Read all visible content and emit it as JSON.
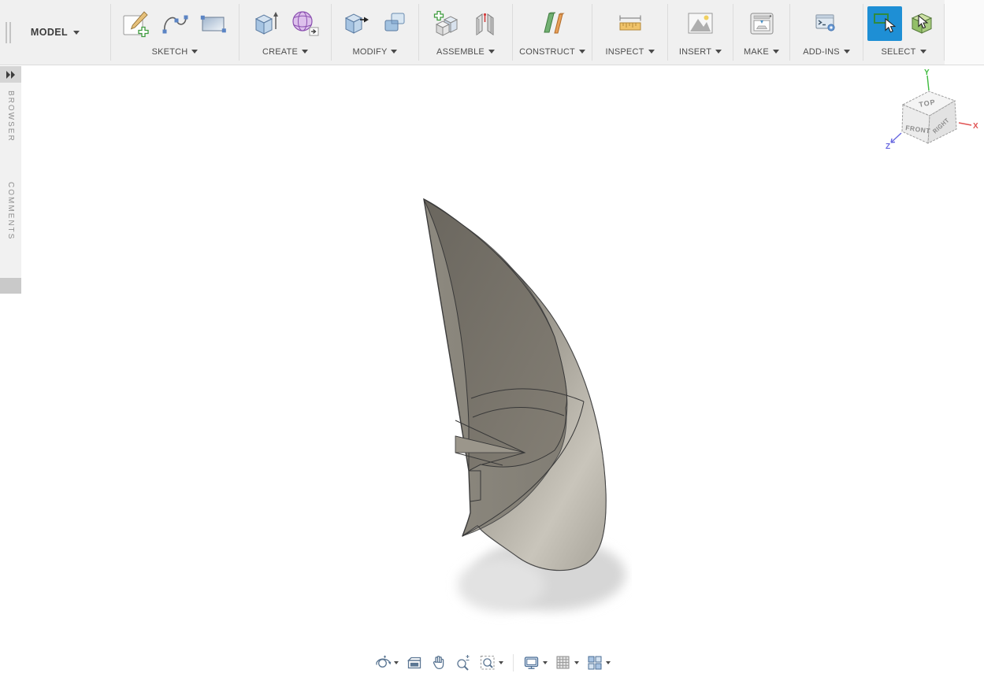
{
  "app": {
    "workspace_label": "MODEL"
  },
  "toolbar": {
    "model": {
      "label": "MODEL"
    },
    "groups": [
      {
        "label": "SKETCH",
        "icons": [
          "create-sketch-icon",
          "spline-icon",
          "two-point-rectangle-icon"
        ]
      },
      {
        "label": "CREATE",
        "icons": [
          "extrude-icon",
          "form-icon"
        ]
      },
      {
        "label": "MODIFY",
        "icons": [
          "press-pull-icon",
          "combine-icon"
        ]
      },
      {
        "label": "ASSEMBLE",
        "icons": [
          "new-component-icon",
          "joint-icon"
        ]
      },
      {
        "label": "CONSTRUCT",
        "icons": [
          "offset-plane-icon"
        ]
      },
      {
        "label": "INSPECT",
        "icons": [
          "measure-icon"
        ]
      },
      {
        "label": "INSERT",
        "icons": [
          "insert-image-icon"
        ]
      },
      {
        "label": "MAKE",
        "icons": [
          "print-3d-icon"
        ]
      },
      {
        "label": "ADD-INS",
        "icons": [
          "scripts-addins-icon"
        ]
      },
      {
        "label": "SELECT",
        "icons": [
          "window-select-icon",
          "paint-select-icon"
        ],
        "active_icon": "window-select-icon"
      }
    ]
  },
  "sidebar": {
    "expand_icon": "expand-panel-icon",
    "tabs": [
      {
        "label": "BROWSER"
      },
      {
        "label": "COMMENTS"
      }
    ]
  },
  "viewcube": {
    "faces": {
      "top": "TOP",
      "front": "FRONT",
      "right": "RIGHT"
    },
    "axes": [
      {
        "label": "Y",
        "color": "#3dbb3d"
      },
      {
        "label": "X",
        "color": "#e05252"
      },
      {
        "label": "Z",
        "color": "#6a6ae0"
      }
    ]
  },
  "navbar": {
    "items": [
      {
        "name": "orbit-icon",
        "caret": true
      },
      {
        "name": "look-at-icon",
        "caret": false
      },
      {
        "name": "pan-icon",
        "caret": false
      },
      {
        "name": "zoom-icon",
        "caret": false
      },
      {
        "name": "fit-icon",
        "caret": true
      },
      {
        "name": "display-settings-icon",
        "caret": true
      },
      {
        "name": "grid-layout-icon",
        "caret": true
      },
      {
        "name": "viewports-icon",
        "caret": true
      }
    ]
  },
  "colors": {
    "toolbar_bg": "#f0f0f0",
    "canvas_bg": "#ffffff",
    "select_active_bg": "#1e8fd5",
    "axis_x": "#e05252",
    "axis_y": "#3dbb3d",
    "axis_z": "#6a6ae0",
    "model_base": "#8d897f",
    "model_highlight": "#c9c5bb",
    "model_interior": "#6e6a62"
  }
}
